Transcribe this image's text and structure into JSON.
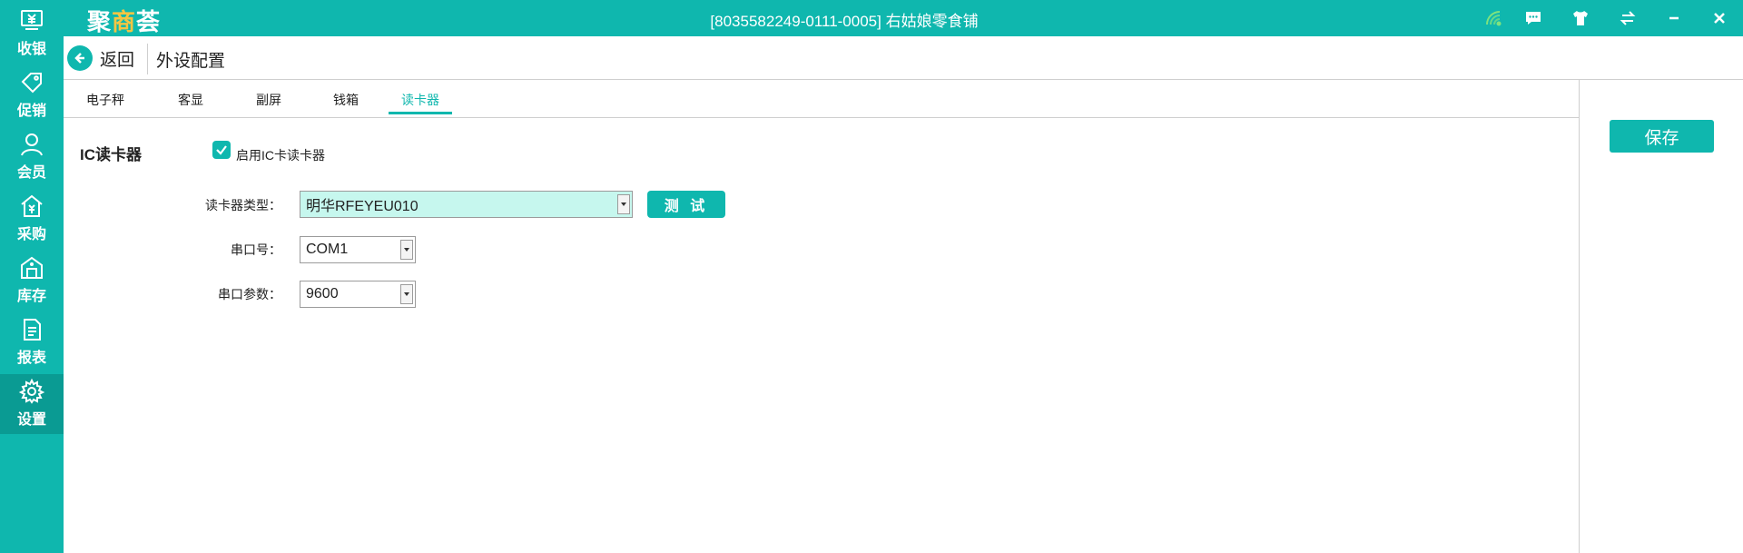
{
  "sidebar": {
    "items": [
      {
        "label": "收银",
        "icon": "cashier-icon"
      },
      {
        "label": "促销",
        "icon": "tag-icon"
      },
      {
        "label": "会员",
        "icon": "member-icon"
      },
      {
        "label": "采购",
        "icon": "purchase-icon"
      },
      {
        "label": "库存",
        "icon": "warehouse-icon"
      },
      {
        "label": "报表",
        "icon": "report-icon"
      },
      {
        "label": "设置",
        "icon": "gear-icon",
        "active": true
      }
    ]
  },
  "topbar": {
    "logo": {
      "part1": "聚",
      "part2": "商",
      "part3": "荟"
    },
    "title": "[8035582249-0111-0005] 右姑娘零食铺",
    "icons": [
      "wifi-icon",
      "message-icon",
      "shirt-icon",
      "switch-icon",
      "minimize-icon",
      "close-icon"
    ]
  },
  "header": {
    "back_label": "返回",
    "page_title": "外设配置"
  },
  "tabs": [
    {
      "label": "电子秤"
    },
    {
      "label": "客显"
    },
    {
      "label": "副屏"
    },
    {
      "label": "钱箱"
    },
    {
      "label": "读卡器",
      "active": true
    }
  ],
  "reader": {
    "section_label": "IC读卡器",
    "enable_label": "启用IC卡读卡器",
    "enabled": true,
    "type_label": "读卡器类型：",
    "type_value": "明华RFEYEU010",
    "test_label": "测 试",
    "port_label": "串口号：",
    "port_value": "COM1",
    "param_label": "串口参数：",
    "param_value": "9600"
  },
  "actions": {
    "save_label": "保存"
  },
  "colors": {
    "primary": "#0fb7ae",
    "primary_active": "#0a9b93",
    "select_highlight": "#c6f7ee",
    "logo_accent": "#f5c542"
  }
}
